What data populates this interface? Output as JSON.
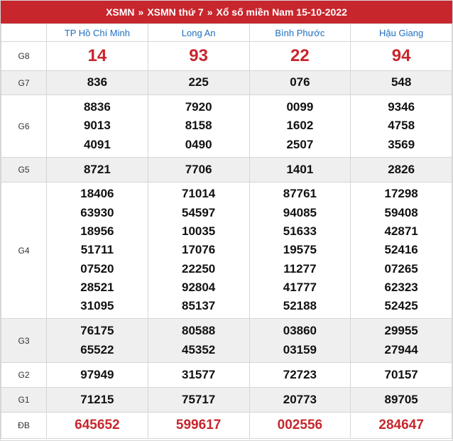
{
  "header": {
    "crumb1": "XSMN",
    "sep": "»",
    "crumb2": "XSMN thứ 7",
    "crumb3": "Xổ số miền Nam 15-10-2022"
  },
  "provinces": [
    "TP Hồ Chí Minh",
    "Long An",
    "Bình Phước",
    "Hậu Giang"
  ],
  "prizes": [
    {
      "label": "G8",
      "values": [
        [
          "14"
        ],
        [
          "93"
        ],
        [
          "22"
        ],
        [
          "94"
        ]
      ]
    },
    {
      "label": "G7",
      "values": [
        [
          "836"
        ],
        [
          "225"
        ],
        [
          "076"
        ],
        [
          "548"
        ]
      ]
    },
    {
      "label": "G6",
      "values": [
        [
          "8836",
          "9013",
          "4091"
        ],
        [
          "7920",
          "8158",
          "0490"
        ],
        [
          "0099",
          "1602",
          "2507"
        ],
        [
          "9346",
          "4758",
          "3569"
        ]
      ]
    },
    {
      "label": "G5",
      "values": [
        [
          "8721"
        ],
        [
          "7706"
        ],
        [
          "1401"
        ],
        [
          "2826"
        ]
      ]
    },
    {
      "label": "G4",
      "values": [
        [
          "18406",
          "63930",
          "18956",
          "51711",
          "07520",
          "28521",
          "31095"
        ],
        [
          "71014",
          "54597",
          "10035",
          "17076",
          "22250",
          "92804",
          "85137"
        ],
        [
          "87761",
          "94085",
          "51633",
          "19575",
          "11277",
          "41777",
          "52188"
        ],
        [
          "17298",
          "59408",
          "42871",
          "52416",
          "07265",
          "62323",
          "52425"
        ]
      ]
    },
    {
      "label": "G3",
      "values": [
        [
          "76175",
          "65522"
        ],
        [
          "80588",
          "45352"
        ],
        [
          "03860",
          "03159"
        ],
        [
          "29955",
          "27944"
        ]
      ]
    },
    {
      "label": "G2",
      "values": [
        [
          "97949"
        ],
        [
          "31577"
        ],
        [
          "72723"
        ],
        [
          "70157"
        ]
      ]
    },
    {
      "label": "G1",
      "values": [
        [
          "71215"
        ],
        [
          "75717"
        ],
        [
          "20773"
        ],
        [
          "89705"
        ]
      ]
    },
    {
      "label": "ĐB",
      "values": [
        [
          "645652"
        ],
        [
          "599617"
        ],
        [
          "002556"
        ],
        [
          "284647"
        ]
      ]
    }
  ]
}
